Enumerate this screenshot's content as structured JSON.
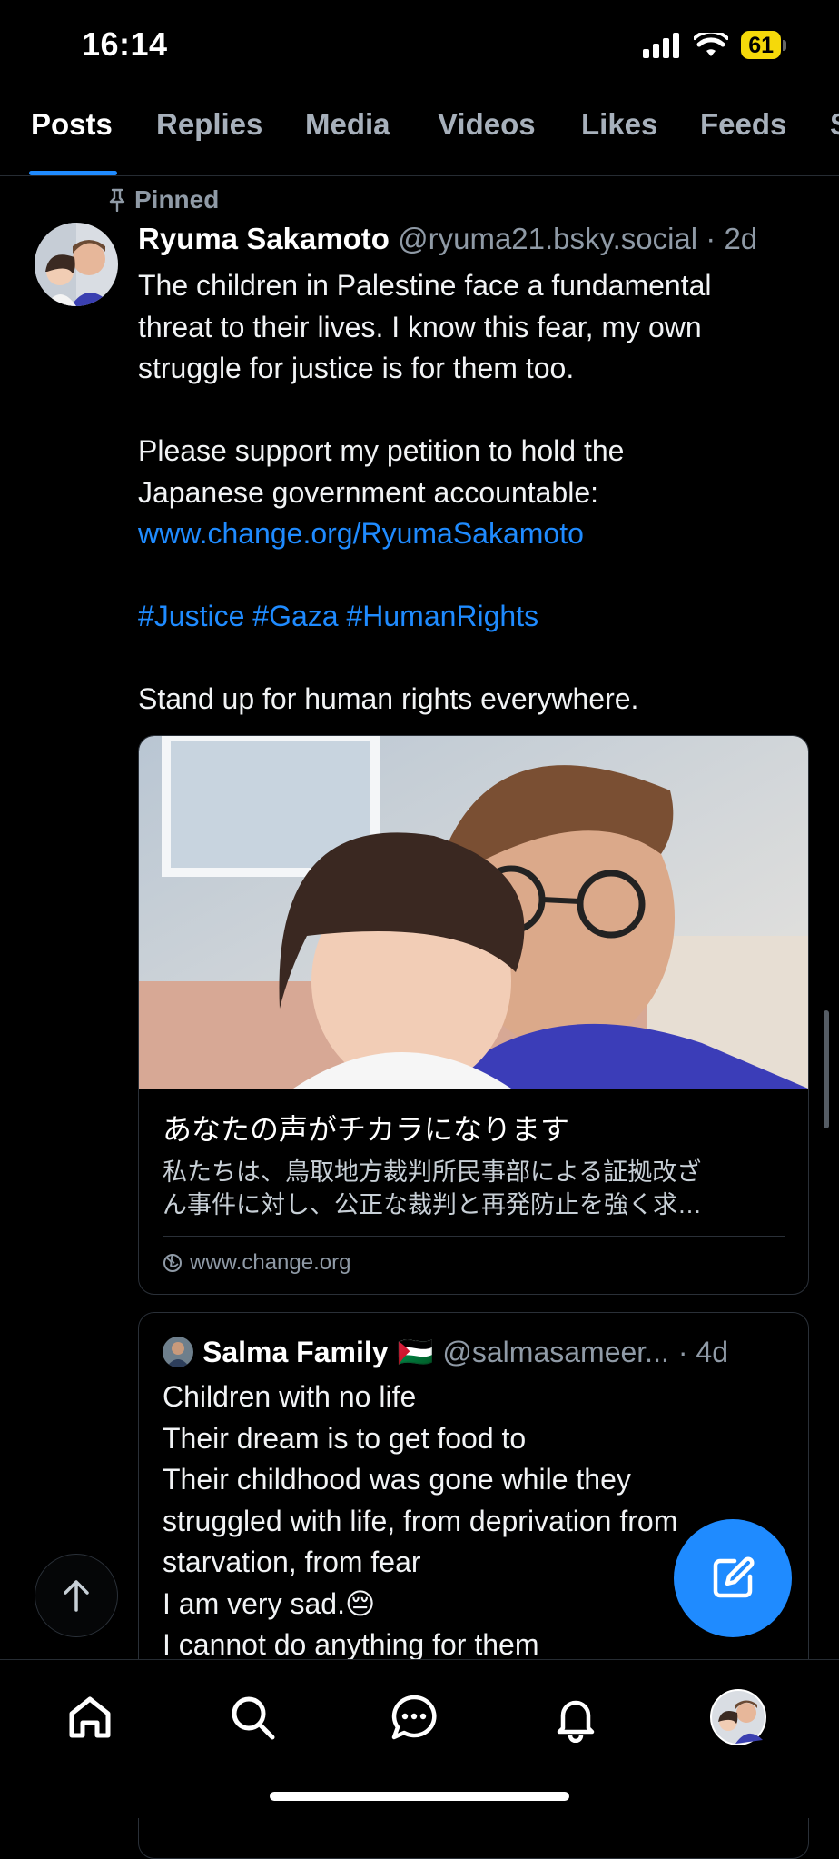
{
  "status": {
    "time": "16:14",
    "battery": "61"
  },
  "tabs": [
    {
      "label": "Posts",
      "active": true
    },
    {
      "label": "Replies"
    },
    {
      "label": "Media"
    },
    {
      "label": "Videos"
    },
    {
      "label": "Likes"
    },
    {
      "label": "Feeds"
    },
    {
      "label": "S"
    }
  ],
  "post": {
    "pinned_label": "Pinned",
    "author": "Ryuma Sakamoto",
    "handle": "@ryuma21.bsky.social",
    "time": "· 2d",
    "lines": {
      "l1": "The children in Palestine face a fundamental",
      "l2": "threat to their lives. I know this fear, my own",
      "l3": "struggle for justice is for them too.",
      "l4": "Please support my petition to hold the",
      "l5": "Japanese government accountable:",
      "link": "www.change.org/RyumaSakamoto",
      "hashtags": "#Justice #Gaza #HumanRights",
      "l6": "Stand up for human rights everywhere."
    },
    "card": {
      "title": "あなたの声がチカラになります",
      "desc_line1": "私たちは、鳥取地方裁判所民事部による証拠改ざ",
      "desc_line2": "ん事件に対し、公正な裁判と再発防止を強く求…",
      "domain": "www.change.org"
    },
    "quote": {
      "author": "Salma Family",
      "flag": "🇵🇸",
      "handle": "@salmasameer...",
      "time": "· 4d",
      "lines": {
        "l1": "Children with no life",
        "l2": "Their dream is to get food to",
        "l3": "Their childhood was gone while they",
        "l4": "struggled with life, from deprivation from",
        "l5": "starvation, from fear",
        "l6": "I am very sad.😔",
        "l7": " I cannot do anything for them"
      }
    }
  },
  "icons": {
    "pin": "pin-icon",
    "globe": "globe-icon",
    "scroll_top": "arrow-up-icon",
    "compose": "compose-icon",
    "nav": [
      "home-icon",
      "search-icon",
      "chat-icon",
      "bell-icon",
      "profile-avatar"
    ]
  },
  "colors": {
    "accent": "#1f8bff",
    "background": "#000000",
    "muted": "#8f9aa6"
  }
}
